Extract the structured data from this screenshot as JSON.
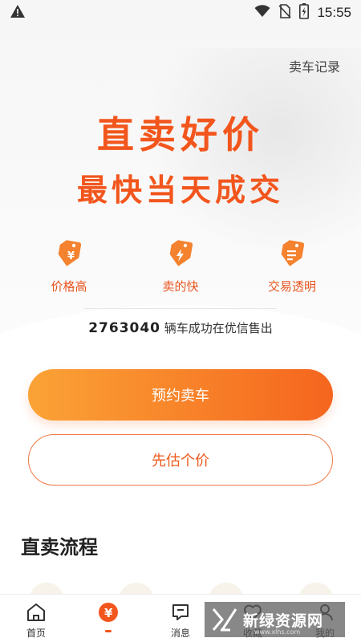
{
  "status_bar": {
    "time": "15:55",
    "icons": [
      "warning-icon",
      "wifi-icon",
      "no-sim-icon",
      "battery-charging-icon"
    ]
  },
  "header": {
    "history_link": "卖车记录"
  },
  "hero": {
    "headline_1": "直卖好价",
    "headline_2": "最快当天成交"
  },
  "features": [
    {
      "label": "价格高",
      "icon": "price-tag-yen-icon"
    },
    {
      "label": "卖的快",
      "icon": "price-tag-bolt-icon"
    },
    {
      "label": "交易透明",
      "icon": "price-tag-list-icon"
    }
  ],
  "stats": {
    "sold_count": "2763040",
    "sold_text": " 辆车成功在优信售出"
  },
  "buttons": {
    "primary_label": "预约卖车",
    "secondary_label": "先估个价"
  },
  "process": {
    "title": "直卖流程"
  },
  "tabbar": {
    "tabs": [
      {
        "label": "首页",
        "icon": "home-icon"
      },
      {
        "label": "",
        "icon": "sell-yen-icon",
        "active": true
      },
      {
        "label": "消息",
        "icon": "message-icon"
      },
      {
        "label": "收藏",
        "icon": "heart-icon"
      },
      {
        "label": "我的",
        "icon": "profile-icon"
      }
    ]
  },
  "watermark": {
    "text": "新绿资源网",
    "sub": "www.xlhs.com"
  },
  "colors": {
    "accent": "#f2561d",
    "gradient_start": "#fba336",
    "gradient_end": "#f5651e"
  }
}
